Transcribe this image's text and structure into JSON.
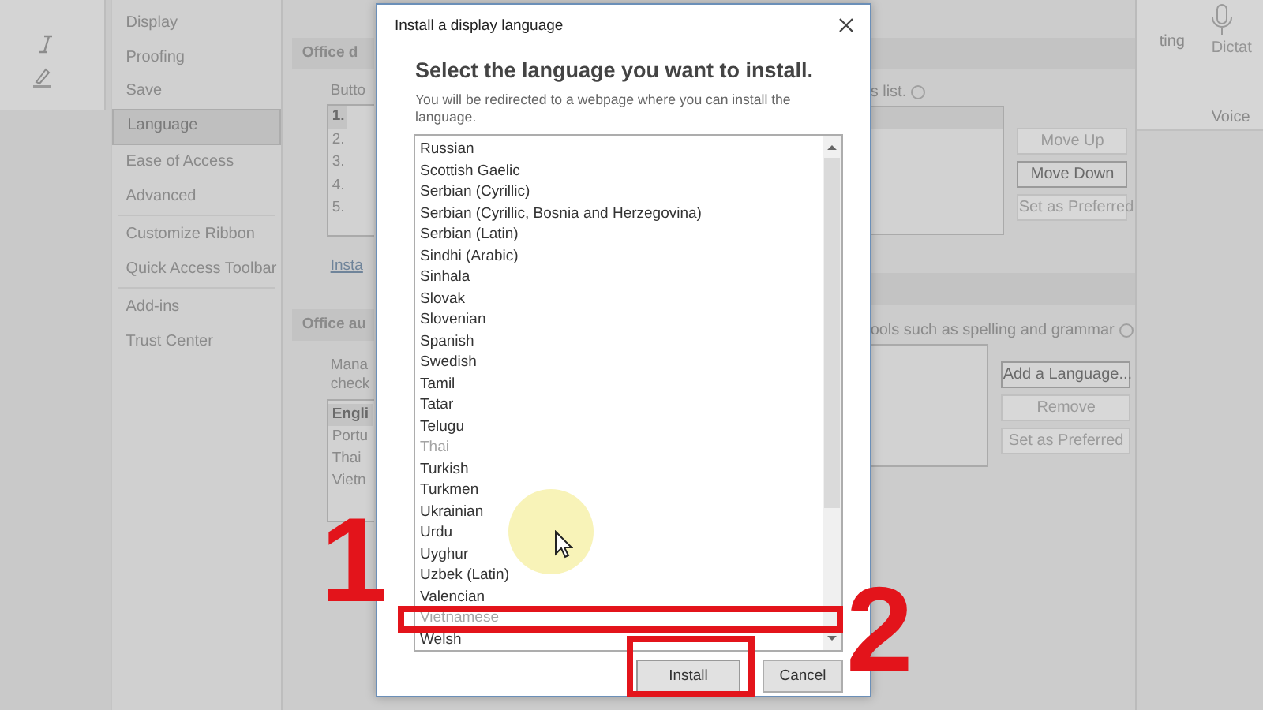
{
  "ribbon_right": {
    "labels": [
      "ting",
      "Dictat"
    ],
    "group": "Voice"
  },
  "sidebar": {
    "items": [
      {
        "label": "Display",
        "selected": false,
        "divider_after": false
      },
      {
        "label": "Proofing",
        "selected": false,
        "divider_after": false
      },
      {
        "label": "Save",
        "selected": false,
        "divider_after": false
      },
      {
        "label": "Language",
        "selected": true,
        "divider_after": false
      },
      {
        "label": "Ease of Access",
        "selected": false,
        "divider_after": false
      },
      {
        "label": "Advanced",
        "selected": false,
        "divider_after": true
      },
      {
        "label": "Customize Ribbon",
        "selected": false,
        "divider_after": false
      },
      {
        "label": "Quick Access Toolbar",
        "selected": false,
        "divider_after": true
      },
      {
        "label": "Add-ins",
        "selected": false,
        "divider_after": false
      },
      {
        "label": "Trust Center",
        "selected": false,
        "divider_after": false
      }
    ]
  },
  "display_section": {
    "header": "Office d",
    "label": "Butto",
    "list": [
      {
        "label": "1.",
        "selected": true
      },
      {
        "label": "2.",
        "selected": false
      },
      {
        "label": "3.",
        "selected": false
      },
      {
        "label": "4.",
        "selected": false
      },
      {
        "label": "5.",
        "selected": false
      }
    ],
    "link": "Insta",
    "note": "s list.",
    "buttons": [
      {
        "label": "Move Up",
        "disabled": true
      },
      {
        "label": "Move Down",
        "disabled": false
      },
      {
        "label": "Set as Preferred",
        "disabled": true
      }
    ]
  },
  "authoring_section": {
    "header": "Office au",
    "description": [
      "Mana",
      "check"
    ],
    "note": "ools such as spelling and grammar",
    "list": [
      {
        "label": "Engli",
        "selected": true
      },
      {
        "label": "Portu",
        "selected": false
      },
      {
        "label": "Thai",
        "selected": false
      },
      {
        "label": "Vietn",
        "selected": false
      }
    ],
    "buttons": [
      {
        "label": "Add a Language...",
        "disabled": false
      },
      {
        "label": "Remove",
        "disabled": true
      },
      {
        "label": "Set as Preferred",
        "disabled": true
      }
    ]
  },
  "dialog": {
    "title": "Install a display language",
    "heading": "Select the language you want to install.",
    "description": "You will be redirected to a webpage where you can install the language.",
    "languages": [
      {
        "label": "Russian",
        "disabled": false
      },
      {
        "label": "Scottish Gaelic",
        "disabled": false
      },
      {
        "label": "Serbian (Cyrillic)",
        "disabled": false
      },
      {
        "label": "Serbian (Cyrillic, Bosnia and Herzegovina)",
        "disabled": false
      },
      {
        "label": "Serbian (Latin)",
        "disabled": false
      },
      {
        "label": "Sindhi (Arabic)",
        "disabled": false
      },
      {
        "label": "Sinhala",
        "disabled": false
      },
      {
        "label": "Slovak",
        "disabled": false
      },
      {
        "label": "Slovenian",
        "disabled": false
      },
      {
        "label": "Spanish",
        "disabled": false
      },
      {
        "label": "Swedish",
        "disabled": false
      },
      {
        "label": "Tamil",
        "disabled": false
      },
      {
        "label": "Tatar",
        "disabled": false
      },
      {
        "label": "Telugu",
        "disabled": false
      },
      {
        "label": "Thai",
        "disabled": true
      },
      {
        "label": "Turkish",
        "disabled": false
      },
      {
        "label": "Turkmen",
        "disabled": false
      },
      {
        "label": "Ukrainian",
        "disabled": false
      },
      {
        "label": "Urdu",
        "disabled": false
      },
      {
        "label": "Uyghur",
        "disabled": false
      },
      {
        "label": "Uzbek (Latin)",
        "disabled": false
      },
      {
        "label": "Valencian",
        "disabled": false
      },
      {
        "label": "Vietnamese",
        "disabled": true
      },
      {
        "label": "Welsh",
        "disabled": false
      }
    ],
    "buttons": [
      {
        "label": "Install",
        "kind": "primary"
      },
      {
        "label": "Cancel",
        "kind": "default"
      }
    ]
  },
  "annotations": [
    {
      "kind": "number",
      "text": "1"
    },
    {
      "kind": "number",
      "text": "2"
    },
    {
      "kind": "frame"
    },
    {
      "kind": "frame"
    }
  ]
}
